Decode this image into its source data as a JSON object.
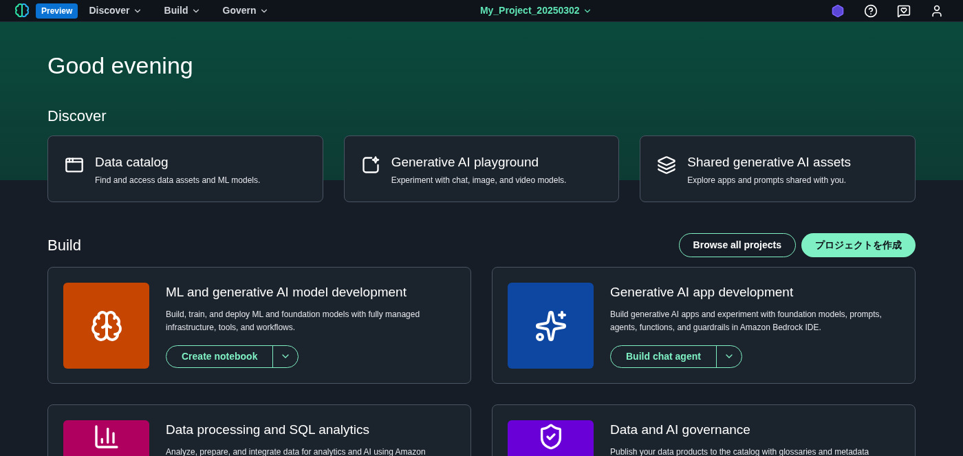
{
  "nav": {
    "badge": "Preview",
    "menus": [
      "Discover",
      "Build",
      "Govern"
    ],
    "project": "My_Project_20250302"
  },
  "greeting": "Good evening",
  "discover": {
    "heading": "Discover",
    "cards": [
      {
        "kind": "catalog",
        "title": "Data catalog",
        "description": "Find and access data assets and ML models."
      },
      {
        "kind": "playground",
        "title": "Generative AI playground",
        "description": "Experiment with chat, image, and video models."
      },
      {
        "kind": "shared",
        "title": "Shared generative AI assets",
        "description": "Explore apps and prompts shared with you."
      }
    ]
  },
  "build": {
    "heading": "Build",
    "buttons": [
      {
        "kind": "secondary",
        "label": "Browse all projects"
      },
      {
        "kind": "primary",
        "label": "プロジェクトを作成"
      }
    ],
    "cards": [
      {
        "kind": "ml",
        "color": "#c64500",
        "title": "ML and generative AI model development",
        "description": "Build, train, and deploy ML and foundation models with fully managed infrastructure, tools, and workflows.",
        "action": "Create notebook"
      },
      {
        "kind": "genai",
        "color": "#0d47a1",
        "title": "Generative AI app development",
        "description": "Build generative AI apps and experiment with foundation models, prompts, agents, functions, and guardrails in Amazon Bedrock IDE.",
        "action": "Build chat agent"
      },
      {
        "kind": "data",
        "color": "#b0005f",
        "title": "Data processing and SQL analytics",
        "description": "Analyze, prepare, and integrate data for analytics and AI using Amazon"
      },
      {
        "kind": "governance",
        "color": "#6a00d8",
        "title": "Data and AI governance",
        "description": "Publish your data products to the catalog with glossaries and metadata"
      }
    ]
  }
}
